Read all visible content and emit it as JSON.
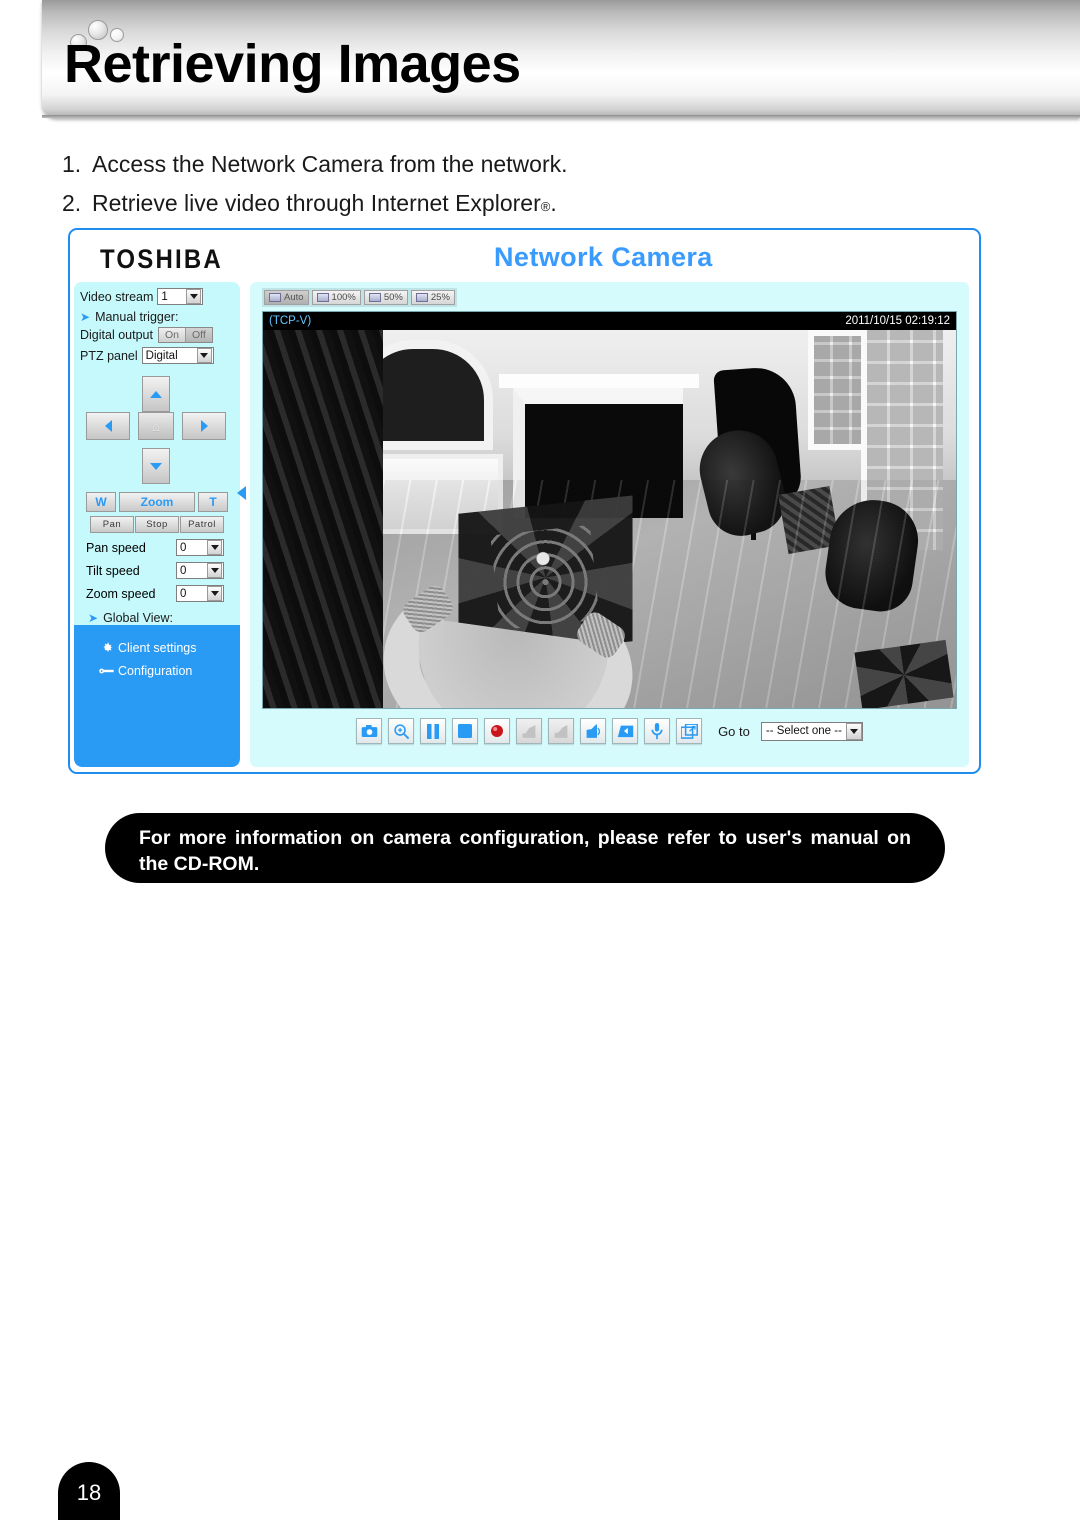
{
  "header": {
    "title": "Retrieving Images"
  },
  "instructions": [
    {
      "num": "1.",
      "text": "Access the Network Camera from the network."
    },
    {
      "num": "2.",
      "text": "Retrieve live video through Internet Explorer",
      "suffix": "."
    }
  ],
  "camera_ui": {
    "brand": "TOSHIBA",
    "title": "Network Camera",
    "sidebar": {
      "video_stream_label": "Video stream",
      "video_stream_value": "1",
      "manual_trigger_label": "Manual trigger:",
      "digital_output_label": "Digital output",
      "digital_output_on": "On",
      "digital_output_off": "Off",
      "ptz_panel_label": "PTZ panel",
      "ptz_panel_value": "Digital",
      "zoom_wide": "W",
      "zoom_label": "Zoom",
      "zoom_tele": "T",
      "pan_button": "Pan",
      "stop_button": "Stop",
      "patrol_button": "Patrol",
      "pan_speed_label": "Pan speed",
      "pan_speed_value": "0",
      "tilt_speed_label": "Tilt speed",
      "tilt_speed_value": "0",
      "zoom_speed_label": "Zoom speed",
      "zoom_speed_value": "0",
      "global_view_label": "Global View:",
      "client_settings": "Client settings",
      "configuration": "Configuration"
    },
    "zoom_buttons": [
      {
        "label": "Auto",
        "active": true
      },
      {
        "label": "100%",
        "active": false
      },
      {
        "label": "50%",
        "active": false
      },
      {
        "label": "25%",
        "active": false
      }
    ],
    "video": {
      "protocol": "(TCP-V)",
      "timestamp": "2011/10/15 02:19:12"
    },
    "controls": [
      {
        "icon": "snapshot-icon",
        "enabled": true
      },
      {
        "icon": "digital-zoom-icon",
        "enabled": true
      },
      {
        "icon": "pause-icon",
        "enabled": true
      },
      {
        "icon": "stop-icon",
        "enabled": true
      },
      {
        "icon": "record-icon",
        "enabled": true
      },
      {
        "icon": "volume-mute-icon",
        "enabled": false
      },
      {
        "icon": "speaker-icon",
        "enabled": false
      },
      {
        "icon": "speaker-volume-icon",
        "enabled": true
      },
      {
        "icon": "storage-folder-icon",
        "enabled": true
      },
      {
        "icon": "microphone-icon",
        "enabled": true
      },
      {
        "icon": "fullscreen-icon",
        "enabled": true
      }
    ],
    "goto": {
      "label": "Go to",
      "value": "-- Select one --"
    }
  },
  "note": {
    "text": "For more information on camera configuration, please refer to user's manual on the CD-ROM."
  },
  "footer": {
    "page_number": "18"
  },
  "colors": {
    "accent_blue": "#2a9bf5",
    "panel_border": "#1f8cf0",
    "sidebar_light": "#c6f9fb",
    "sidebar_dark": "#2a9bf5",
    "title_blue": "#3a9bff"
  }
}
